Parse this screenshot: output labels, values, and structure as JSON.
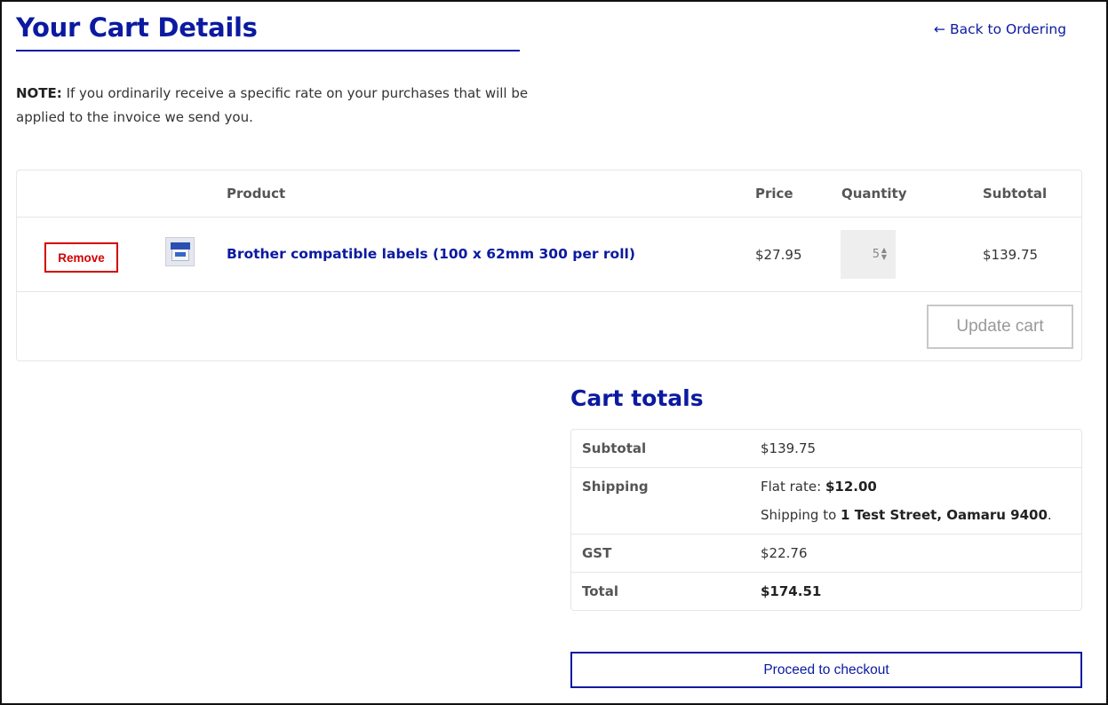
{
  "page": {
    "title": "Your Cart Details",
    "back_link": "Back to Ordering",
    "note_label": "NOTE:",
    "note_text": "If you ordinarily receive a specific rate on your purchases that will be applied to the invoice we send you."
  },
  "cart": {
    "headers": {
      "product": "Product",
      "price": "Price",
      "quantity": "Quantity",
      "subtotal": "Subtotal"
    },
    "items": [
      {
        "remove_label": "Remove",
        "thumbnail_icon": "label-roll-box-image",
        "name": "Brother compatible labels (100 x 62mm 300 per roll)",
        "price": "$27.95",
        "quantity": "5",
        "subtotal": "$139.75"
      }
    ],
    "update_label": "Update cart"
  },
  "totals": {
    "title": "Cart totals",
    "subtotal_label": "Subtotal",
    "subtotal_value": "$139.75",
    "shipping_label": "Shipping",
    "shipping_method": "Flat rate:",
    "shipping_cost": "$12.00",
    "shipping_to_prefix": "Shipping to",
    "shipping_address": "1 Test Street, Oamaru 9400",
    "gst_label": "GST",
    "gst_value": "$22.76",
    "total_label": "Total",
    "total_value": "$174.51"
  },
  "checkout_label": "Proceed to checkout",
  "colors": {
    "brand_blue": "#0b1aa0",
    "remove_red": "#d40000",
    "text": "#333333",
    "border": "#e6e6e6"
  }
}
